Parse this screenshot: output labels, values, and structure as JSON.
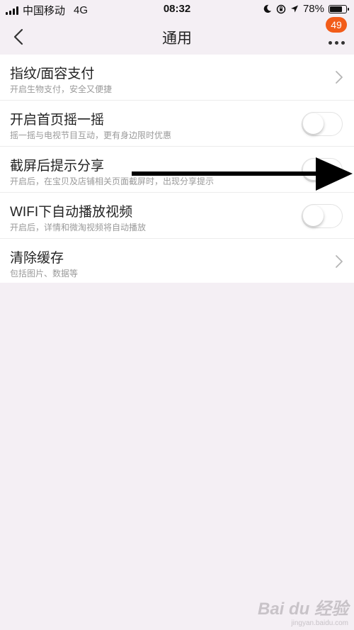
{
  "status_bar": {
    "carrier": "中国移动",
    "network": "4G",
    "time": "08:32",
    "battery": "78%",
    "battery_level": 0.78
  },
  "nav": {
    "title": "通用",
    "badge_count": "49"
  },
  "settings": [
    {
      "title": "指纹/面容支付",
      "subtitle": "开启生物支付，安全又便捷",
      "control": "chevron"
    },
    {
      "title": "开启首页摇一摇",
      "subtitle": "摇一摇与电视节目互动，更有身边限时优惠",
      "control": "toggle",
      "on": false
    },
    {
      "title": "截屏后提示分享",
      "subtitle": "开启后，在宝贝及店铺相关页面截屏时，出现分享提示",
      "control": "toggle",
      "on": false
    },
    {
      "title": "WIFI下自动播放视频",
      "subtitle": "开启后，详情和微淘视频将自动播放",
      "control": "toggle",
      "on": false
    },
    {
      "title": "清除缓存",
      "subtitle": "包括图片、数据等",
      "control": "chevron"
    }
  ],
  "watermark": {
    "brand": "Bai du 经验",
    "url": "jingyan.baidu.com"
  },
  "colors": {
    "background": "#f4eff4",
    "badge": "#f25c19",
    "row_background": "#ffffff",
    "subtitle_text": "#9a9a9a"
  }
}
